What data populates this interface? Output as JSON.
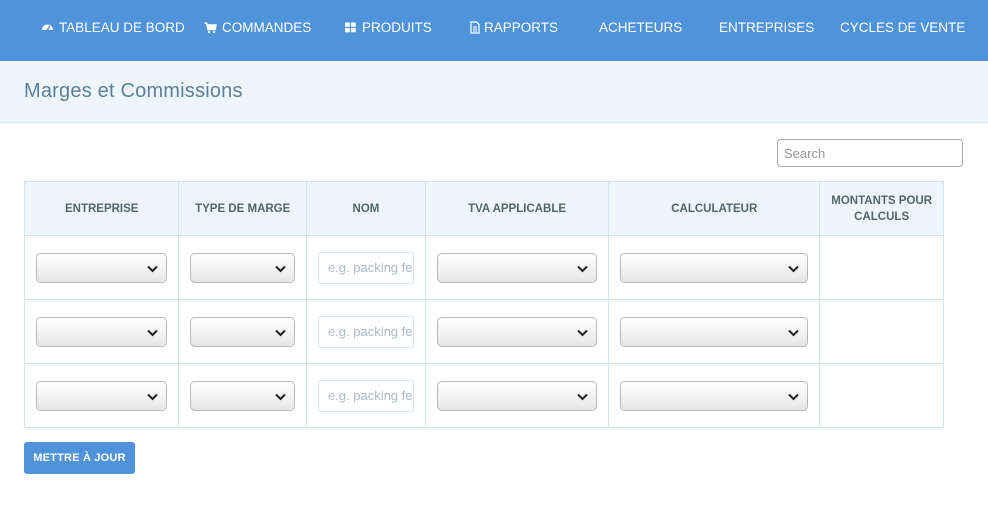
{
  "nav": [
    {
      "label": "TABLEAU DE BORD",
      "icon": "dashboard-icon"
    },
    {
      "label": "COMMANDES",
      "icon": "cart-icon"
    },
    {
      "label": "PRODUITS",
      "icon": "grid-icon"
    },
    {
      "label": "RAPPORTS",
      "icon": "document-icon"
    },
    {
      "label": "ACHETEURS",
      "icon": ""
    },
    {
      "label": "ENTREPRISES",
      "icon": ""
    },
    {
      "label": "CYCLES DE VENTE",
      "icon": ""
    }
  ],
  "page": {
    "title": "Marges et Commissions"
  },
  "search": {
    "placeholder": "Search",
    "value": ""
  },
  "table": {
    "columns": [
      "ENTREPRISE",
      "TYPE DE MARGE",
      "NOM",
      "TVA APPLICABLE",
      "CALCULATEUR",
      "MONTANTS POUR CALCULS"
    ],
    "rows": [
      {
        "entreprise": "",
        "type_marge": "",
        "nom": "",
        "tva": "",
        "calculateur": "",
        "montants": ""
      },
      {
        "entreprise": "",
        "type_marge": "",
        "nom": "",
        "tva": "",
        "calculateur": "",
        "montants": ""
      },
      {
        "entreprise": "",
        "type_marge": "",
        "nom": "",
        "tva": "",
        "calculateur": "",
        "montants": ""
      }
    ],
    "nom_placeholder": "e.g. packing fees"
  },
  "actions": {
    "update_label": "METTRE À JOUR"
  },
  "colors": {
    "nav_bg": "#4f94db",
    "title_bg": "#eef5fd",
    "title_text": "#5d7f99",
    "button_bg": "#4f94db"
  }
}
